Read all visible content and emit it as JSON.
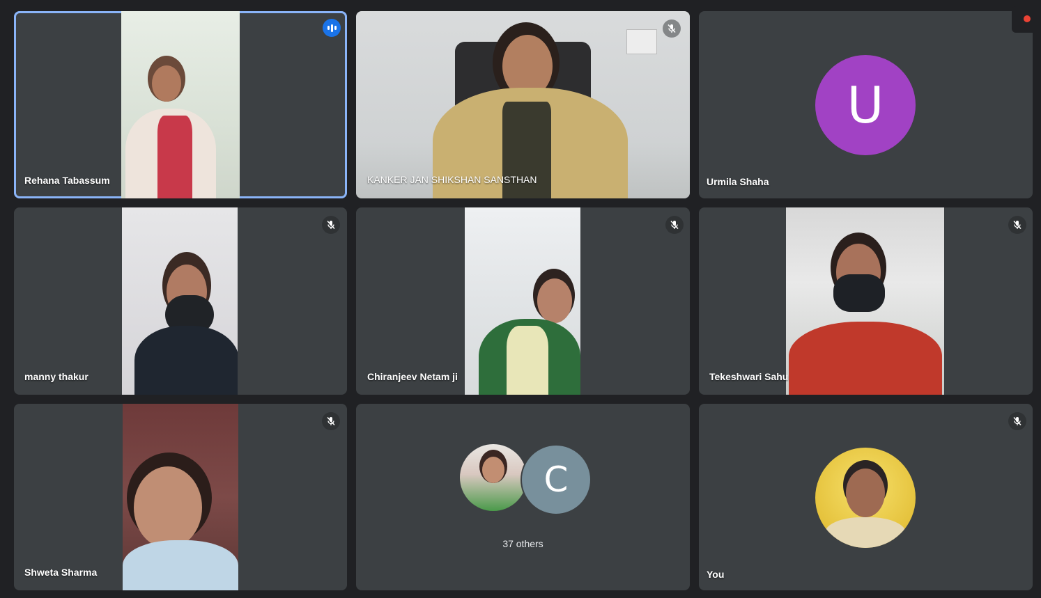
{
  "participants": [
    {
      "name": "Rehana Tabassum",
      "speaking": true
    },
    {
      "name": "KANKER JAN SHIKSHAN SANSTHAN",
      "muted": true
    },
    {
      "name": "Urmila Shaha",
      "avatar_letter": "U",
      "avatar_color": "#a142c4"
    },
    {
      "name": "manny thakur",
      "muted": true
    },
    {
      "name": "Chiranjeev Netam ji",
      "muted": true
    },
    {
      "name": "Tekeshwari Sahu",
      "muted": true
    },
    {
      "name": "Shweta Sharma",
      "muted": true
    },
    {
      "name": "You",
      "muted": true
    }
  ],
  "others_tile": {
    "label": "37 others",
    "avatar_letter": "C",
    "avatar_color": "#78909c"
  },
  "colors": {
    "background": "#202124",
    "tile": "#3c4043",
    "active_outline": "#8ab4f8",
    "recording": "#ea4335"
  }
}
